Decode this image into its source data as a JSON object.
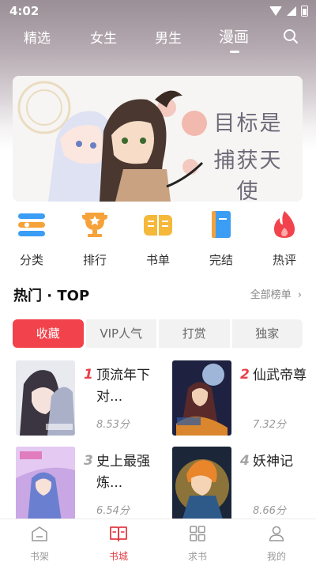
{
  "status": {
    "time": "4:02"
  },
  "top_tabs": [
    {
      "label": "精选"
    },
    {
      "label": "女生"
    },
    {
      "label": "男生"
    },
    {
      "label": "漫画"
    }
  ],
  "banner": {
    "line1": "目标是",
    "line2": "捕获天使"
  },
  "categories": [
    {
      "label": "分类",
      "icon": "category-icon"
    },
    {
      "label": "排行",
      "icon": "trophy-icon"
    },
    {
      "label": "书单",
      "icon": "book-list-icon"
    },
    {
      "label": "完结",
      "icon": "finished-book-icon"
    },
    {
      "label": "热评",
      "icon": "flame-icon"
    }
  ],
  "hot": {
    "title": "热门 · TOP",
    "more_label": "全部榜单",
    "tabs": [
      {
        "label": "收藏"
      },
      {
        "label": "VIP人气"
      },
      {
        "label": "打赏"
      },
      {
        "label": "独家"
      }
    ],
    "books": [
      {
        "rank": "1",
        "title": "顶流年下对...",
        "score": "8.53分"
      },
      {
        "rank": "2",
        "title": "仙武帝尊",
        "score": "7.32分"
      },
      {
        "rank": "3",
        "title": "史上最强炼...",
        "score": "6.54分"
      },
      {
        "rank": "4",
        "title": "妖神记",
        "score": "8.66分"
      }
    ]
  },
  "bottom_nav": [
    {
      "label": "书架",
      "icon": "bookshelf-icon"
    },
    {
      "label": "书城",
      "icon": "bookstore-icon"
    },
    {
      "label": "求书",
      "icon": "grid-icon"
    },
    {
      "label": "我的",
      "icon": "person-icon"
    }
  ],
  "colors": {
    "accent": "#f2434c",
    "rank_top": "#e8414a",
    "rank_other": "#a5a5a5"
  }
}
